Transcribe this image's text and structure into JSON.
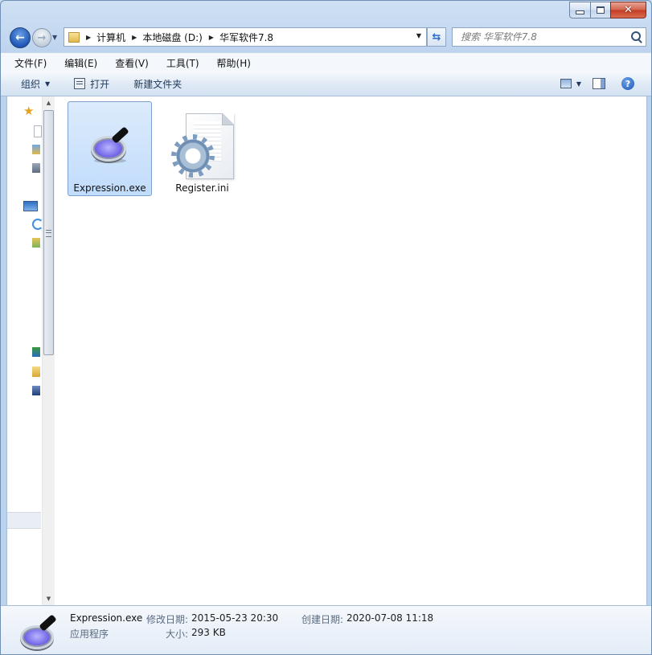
{
  "address": {
    "crumbs": [
      "计算机",
      "本地磁盘 (D:)",
      "华军软件7.8"
    ]
  },
  "search": {
    "placeholder": "搜索 华军软件7.8"
  },
  "menu": [
    "文件(F)",
    "编辑(E)",
    "查看(V)",
    "工具(T)",
    "帮助(H)"
  ],
  "toolbar": {
    "organize": "组织",
    "open": "打开",
    "new_folder": "新建文件夹"
  },
  "files": [
    {
      "name": "Expression.exe",
      "icon": "magnifier-icon",
      "selected": true
    },
    {
      "name": "Register.ini",
      "icon": "config-file-icon",
      "selected": false
    }
  ],
  "details": {
    "name": "Expression.exe",
    "type": "应用程序",
    "modified_label": "修改日期:",
    "modified_value": "2015-05-23 20:30",
    "size_label": "大小:",
    "size_value": "293 KB",
    "created_label": "创建日期:",
    "created_value": "2020-07-08 11:18"
  }
}
